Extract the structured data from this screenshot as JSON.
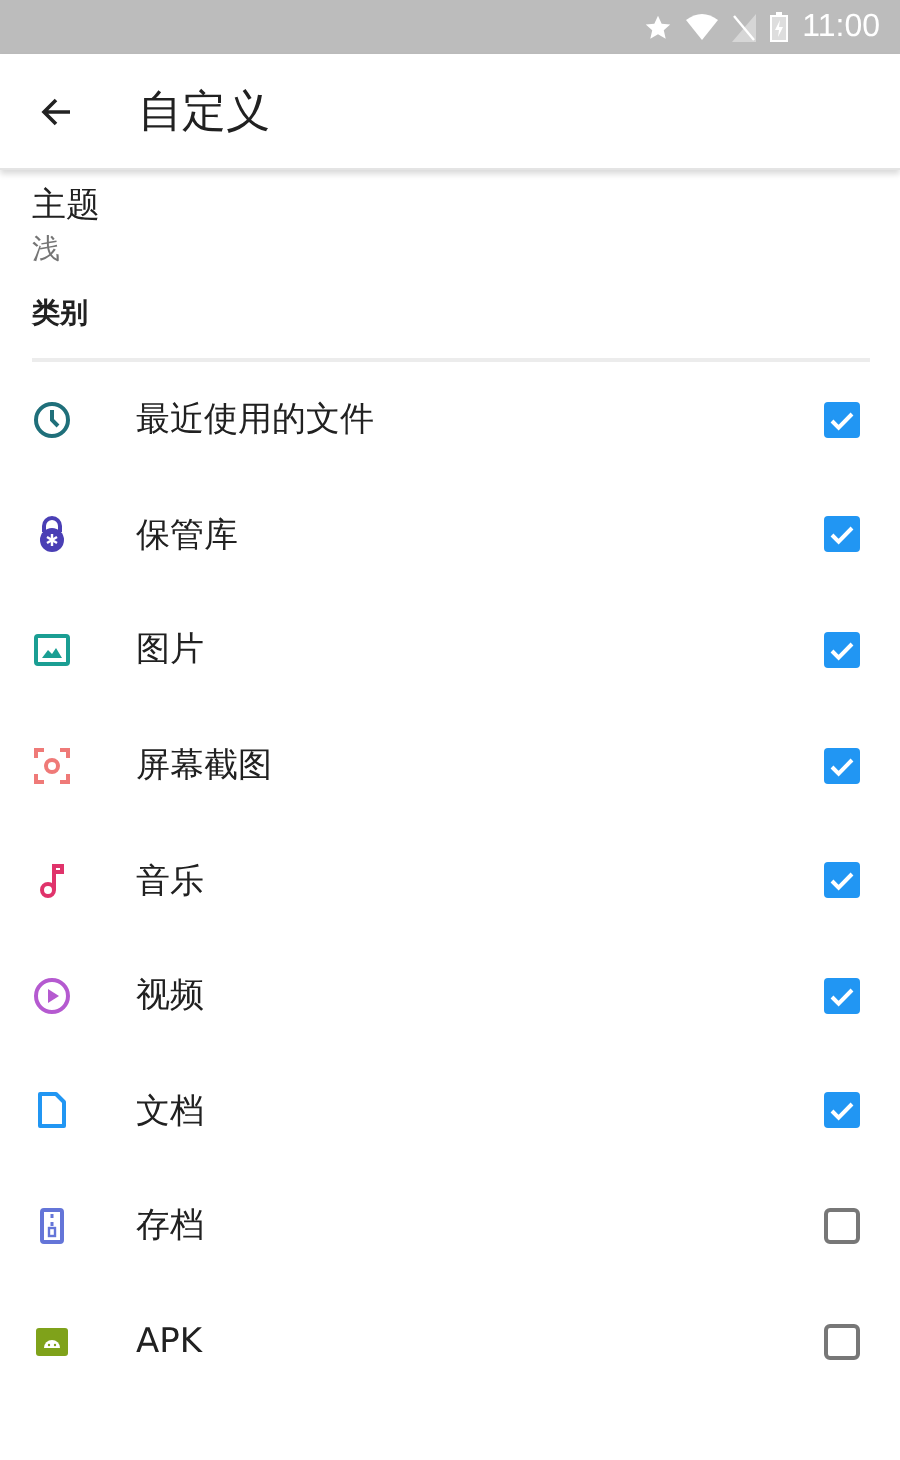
{
  "status_bar": {
    "time": "11:00"
  },
  "toolbar": {
    "title": "自定义"
  },
  "theme": {
    "label": "主题",
    "value": "浅"
  },
  "section": {
    "title": "类别"
  },
  "categories": [
    {
      "kind": "clock",
      "label": "最近使用的文件",
      "checked": true,
      "color": "#1f6f7a"
    },
    {
      "kind": "lock",
      "label": "保管库",
      "checked": true,
      "color": "#4a3fb5"
    },
    {
      "kind": "image",
      "label": "图片",
      "checked": true,
      "color": "#1a9e93"
    },
    {
      "kind": "screenshot",
      "label": "屏幕截图",
      "checked": true,
      "color": "#ef7a78"
    },
    {
      "kind": "music",
      "label": "音乐",
      "checked": true,
      "color": "#e0336b"
    },
    {
      "kind": "video",
      "label": "视频",
      "checked": true,
      "color": "#b55ad0"
    },
    {
      "kind": "doc",
      "label": "文档",
      "checked": true,
      "color": "#2196f3"
    },
    {
      "kind": "archive",
      "label": "存档",
      "checked": false,
      "color": "#6475d8"
    },
    {
      "kind": "android",
      "label": "APK",
      "checked": false,
      "color": "#7fa21a"
    }
  ]
}
